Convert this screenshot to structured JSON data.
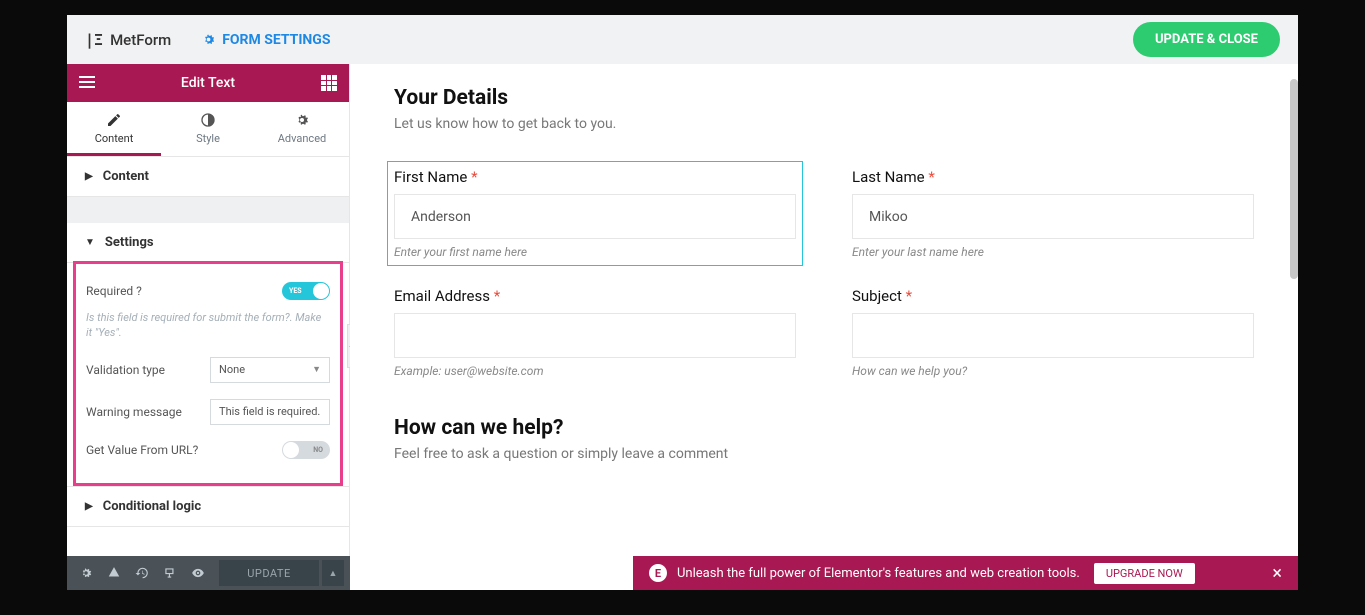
{
  "header": {
    "brand": "MetForm",
    "form_settings": "FORM SETTINGS",
    "update_close": "UPDATE & CLOSE"
  },
  "sidebar": {
    "title": "Edit Text",
    "tabs": {
      "content": "Content",
      "style": "Style",
      "advanced": "Advanced"
    },
    "sections": {
      "content": "Content",
      "settings": "Settings",
      "conditional": "Conditional logic"
    },
    "fields": {
      "required_label": "Required ?",
      "required_help": "Is this field is required for submit the form?. Make it \"Yes\".",
      "validation_label": "Validation type",
      "validation_value": "None",
      "warning_label": "Warning message",
      "warning_value": "This field is required.",
      "geturl_label": "Get Value From URL?",
      "yes": "YES",
      "no": "NO"
    }
  },
  "canvas": {
    "h1": "Your Details",
    "sub1": "Let us know how to get back to you.",
    "first_name": {
      "label": "First Name",
      "value": "Anderson",
      "hint": "Enter your first name here"
    },
    "last_name": {
      "label": "Last Name",
      "value": "Mikoo",
      "hint": "Enter your last name here"
    },
    "email": {
      "label": "Email Address",
      "hint": "Example: user@website.com"
    },
    "subject": {
      "label": "Subject",
      "hint": "How can we help you?"
    },
    "h2": "How can we help?",
    "sub2": "Feel free to ask a question or simply leave a comment"
  },
  "footer": {
    "update": "UPDATE",
    "promo_text": "Unleash the full power of Elementor's features and web creation tools.",
    "upgrade": "UPGRADE NOW"
  }
}
